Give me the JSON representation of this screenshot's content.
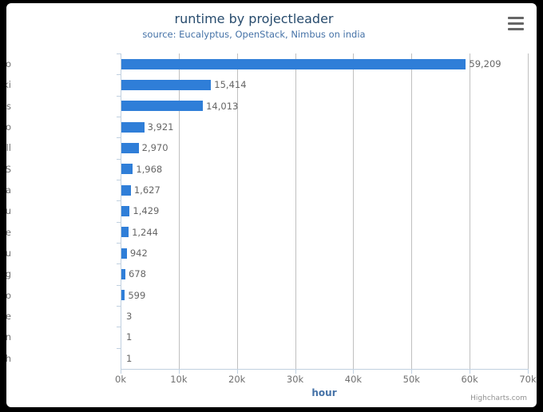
{
  "chart": {
    "title": "runtime by projectleader",
    "subtitle": "source: Eucalyptus, OpenStack, Nimbus on india",
    "credits": "Highcharts.com",
    "export_icon": "hamburger-menu-icon",
    "bar_color": "#2f7ed8",
    "title_color": "#274b6d",
    "subtitle_color": "#4572a7",
    "axis_label_color": "#707070"
  },
  "chart_data": {
    "type": "bar",
    "title": "runtime by projectleader",
    "subtitle": "source: Eucalyptus, OpenStack, Nimbus on india",
    "xlabel": "hour",
    "ylabel": "",
    "orientation": "horizontal",
    "grid": true,
    "legend": false,
    "xlim": [
      0,
      70000
    ],
    "xticks": [
      0,
      10000,
      20000,
      30000,
      40000,
      50000,
      60000,
      70000
    ],
    "xticklabels": [
      "0k",
      "10k",
      "20k",
      "30k",
      "40k",
      "50k",
      "60k",
      "70k"
    ],
    "categories": [
      "Massimo Canonico",
      "Gregor von Laszewski",
      "Claire Le Goues",
      "Paolo Romano",
      "Paul Marshall",
      "Sharath S",
      "Shantenu Jha",
      "Judy Qiu",
      "Mats Rynge",
      "Tak-Lon Wu",
      "Lizhe Wang",
      "Renato Figueiredo",
      "Hyungro Lee",
      "Yogesh Simmhan",
      "Preston Smith"
    ],
    "values": [
      59209,
      15414,
      14013,
      3921,
      2970,
      1968,
      1627,
      1429,
      1244,
      942,
      678,
      599,
      3,
      1,
      1
    ],
    "value_labels": [
      "59,209",
      "15,414",
      "14,013",
      "3,921",
      "2,970",
      "1,968",
      "1,627",
      "1,429",
      "1,244",
      "942",
      "678",
      "599",
      "3",
      "1",
      "1"
    ]
  },
  "xaxis": {
    "title": "hour"
  }
}
